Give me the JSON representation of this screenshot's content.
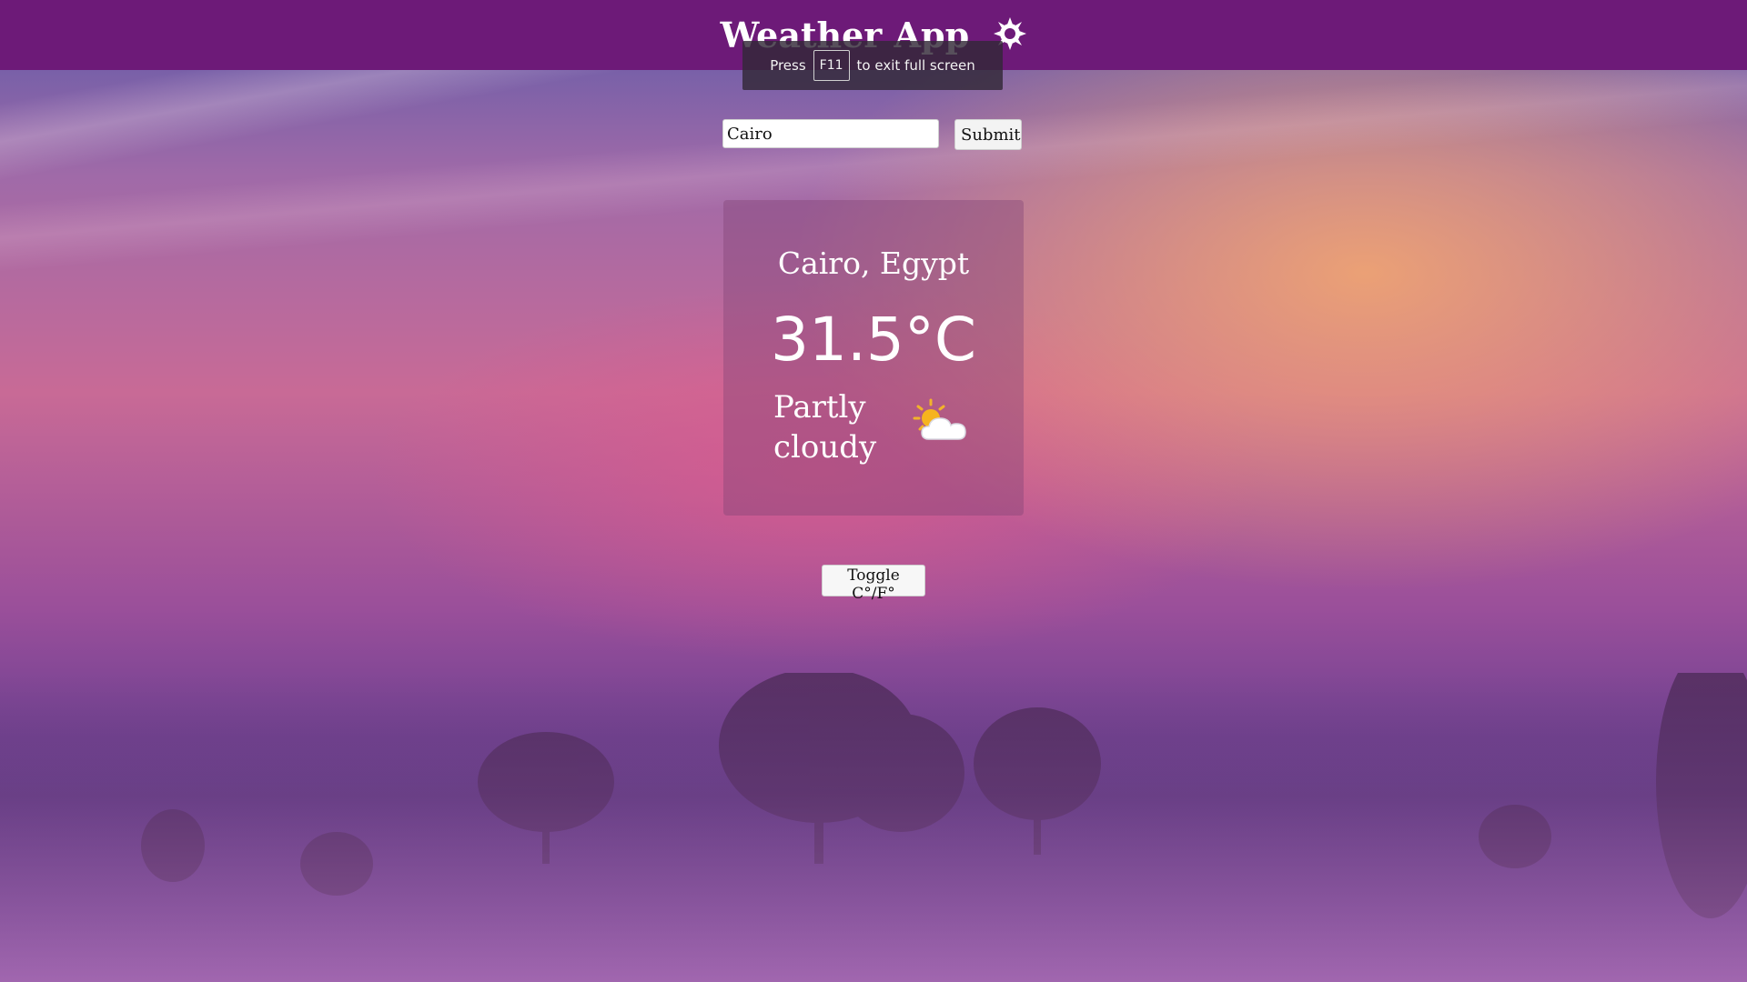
{
  "header": {
    "title": "Weather App",
    "title_icon": "sun-gear-icon",
    "bg_color": "#6d1a78"
  },
  "fullscreen_toast": {
    "prefix": "Press",
    "key": "F11",
    "suffix": "to exit full screen"
  },
  "search": {
    "value": "Cairo",
    "placeholder": "",
    "submit_label": "Submit"
  },
  "weather": {
    "location": "Cairo, Egypt",
    "temperature": "31.5°C",
    "condition_line1": "Partly",
    "condition_line2": "cloudy",
    "condition_icon": "partly-cloudy-icon"
  },
  "controls": {
    "toggle_label": "Toggle C°/F°"
  }
}
